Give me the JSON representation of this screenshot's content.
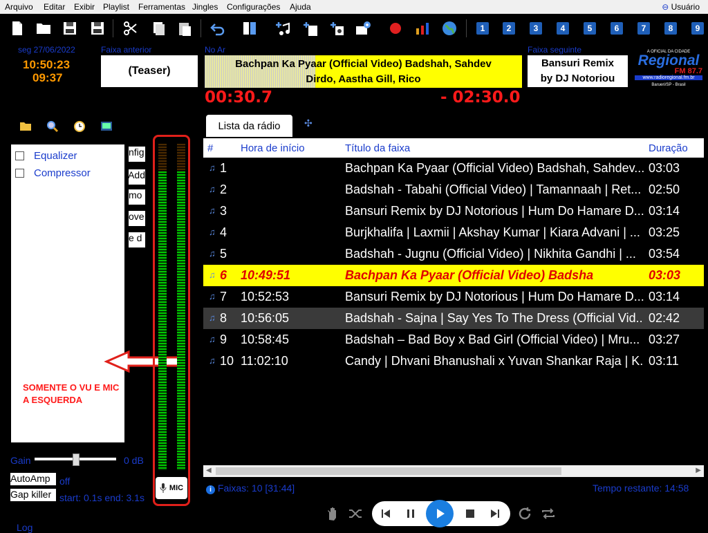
{
  "menu": {
    "items": [
      "Arquivo",
      "Editar",
      "Exibir",
      "Playlist",
      "Ferramentas",
      "Jingles",
      "Configurações",
      "Ajuda"
    ],
    "user": "Usuário"
  },
  "toolbar": {
    "icons": [
      "new-file-icon",
      "open-folder-icon",
      "save-icon",
      "save-as-icon",
      "cut-icon",
      "copy-icon",
      "paste-icon",
      "undo-icon",
      "split-view-icon",
      "add-music-icon",
      "add-list-icon",
      "add-jingle-icon",
      "add-mail-icon",
      "record-icon",
      "stats-icon",
      "globe-icon"
    ],
    "numbers": [
      "1",
      "2",
      "3",
      "4",
      "5",
      "6",
      "7",
      "8",
      "9"
    ]
  },
  "info": {
    "date": "seg 27/06/2022",
    "clock": "10:50:23",
    "clock2": "09:37",
    "prev_label": "Faixa anterior",
    "prev_track": "(Teaser)",
    "onair_label": "No Ar",
    "onair_line1": "Bachpan Ka Pyaar (Official Video) Badshah, Sahdev",
    "onair_line2": "Dirdo, Aastha Gill, Rico",
    "elapsed": "00:30.7",
    "remaining": "- 02:30.0",
    "next_label": "Faixa seguinte",
    "next_line1": "Bansuri Remix",
    "next_line2": "by DJ Notoriou",
    "logo_top": "A OFICIAL DA CIDADE",
    "logo_name": "Regional",
    "logo_freq": "FM 87.7",
    "logo_url": "www.radioregional.fm.br",
    "logo_city": "Barueri/SP - Brasil"
  },
  "left": {
    "effects": [
      "Equalizer",
      "Compressor"
    ],
    "side_buttons": [
      "nfig",
      "Add",
      "mo",
      "ove",
      "e d"
    ],
    "gain_label": "Gain",
    "gain_value": "0 dB",
    "gain_level": 0.5,
    "autoamp_label": "AutoAmp",
    "autoamp_state": "off",
    "gapkiller_label": "Gap killer",
    "gapkiller_state": "start: 0.1s end: 3.1s",
    "log_label": "Log",
    "mic_label": "MIC"
  },
  "annotation": {
    "line1": "SOMENTE O VU E MIC",
    "line2": "A ESQUERDA"
  },
  "playlist": {
    "tab": "Lista da rádio",
    "columns": [
      "#",
      "Hora de início",
      "Título da faixa",
      "Duração"
    ],
    "rows": [
      {
        "n": "1",
        "start": "",
        "title": "Bachpan Ka Pyaar (Official Video) Badshah, Sahdev...",
        "dur": "03:03"
      },
      {
        "n": "2",
        "start": "",
        "title": "Badshah - Tabahi (Official Video) | Tamannaah | Ret...",
        "dur": "02:50"
      },
      {
        "n": "3",
        "start": "",
        "title": "Bansuri Remix by DJ Notorious | Hum Do Hamare D...",
        "dur": "03:14"
      },
      {
        "n": "4",
        "start": "",
        "title": "Burjkhalifa | Laxmii | Akshay Kumar | Kiara Advani | ...",
        "dur": "03:25"
      },
      {
        "n": "5",
        "start": "",
        "title": "Badshah - Jugnu (Official Video) | Nikhita Gandhi | ...",
        "dur": "03:54"
      },
      {
        "n": "6",
        "start": "10:49:51",
        "title": "Bachpan Ka Pyaar (Official Video) Badsha",
        "dur": "03:03"
      },
      {
        "n": "7",
        "start": "10:52:53",
        "title": "Bansuri Remix by DJ Notorious | Hum Do Hamare D...",
        "dur": "03:14"
      },
      {
        "n": "8",
        "start": "10:56:05",
        "title": "Badshah - Sajna | Say Yes To The Dress (Official Vid...",
        "dur": "02:42"
      },
      {
        "n": "9",
        "start": "10:58:45",
        "title": "Badshah – Bad Boy x Bad Girl (Official Video) | Mru...",
        "dur": "03:27"
      },
      {
        "n": "10",
        "start": "11:02:10",
        "title": "Candy | Dhvani Bhanushali x Yuvan Shankar Raja | K...",
        "dur": "03:11"
      }
    ],
    "footer_tracks": "Faixas: 10 [31:44]",
    "footer_remaining": "Tempo restante: 14:58"
  },
  "colors": {
    "accent": "#1a3ccc",
    "onair": "#ffff00",
    "timer": "#ff1a1a",
    "clock": "#ff9900"
  }
}
